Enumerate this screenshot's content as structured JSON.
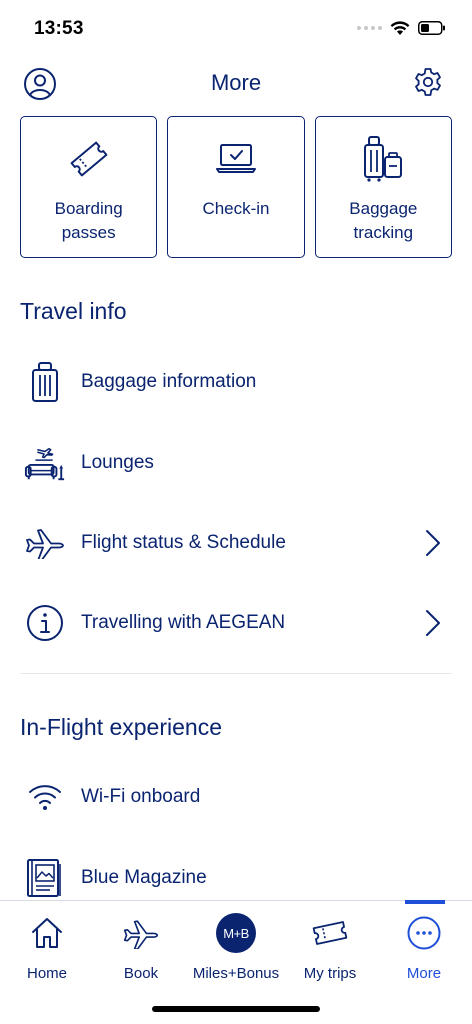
{
  "status_bar": {
    "time": "13:53"
  },
  "header": {
    "title": "More"
  },
  "quick_actions": [
    {
      "label": "Boarding\npasses",
      "icon": "ticket-icon"
    },
    {
      "label": "Check-in",
      "icon": "laptop-check-icon"
    },
    {
      "label": "Baggage\ntracking",
      "icon": "luggage-tracking-icon"
    }
  ],
  "travel_info": {
    "title": "Travel info",
    "items": [
      {
        "label": "Baggage information",
        "icon": "suitcase-icon",
        "chevron": false
      },
      {
        "label": "Lounges",
        "icon": "lounge-sofa-icon",
        "chevron": false
      },
      {
        "label": "Flight status & Schedule",
        "icon": "plane-icon",
        "chevron": true
      },
      {
        "label": "Travelling with AEGEAN",
        "icon": "info-icon",
        "chevron": true
      }
    ]
  },
  "inflight": {
    "title": "In-Flight experience",
    "items": [
      {
        "label": "Wi-Fi onboard",
        "icon": "wifi-icon"
      },
      {
        "label": "Blue Magazine",
        "icon": "magazine-icon"
      }
    ]
  },
  "tabs": [
    {
      "label": "Home",
      "icon": "home-icon",
      "active": false
    },
    {
      "label": "Book",
      "icon": "plane-icon",
      "active": false
    },
    {
      "label": "Miles+Bonus",
      "icon": "miles-bonus-badge",
      "badge": "M+B",
      "active": false
    },
    {
      "label": "My trips",
      "icon": "ticket-icon",
      "active": false
    },
    {
      "label": "More",
      "icon": "more-dots-icon",
      "active": true
    }
  ],
  "colors": {
    "primary": "#0a2470",
    "accent": "#1f4fd8",
    "divider": "#e6e8ee"
  }
}
